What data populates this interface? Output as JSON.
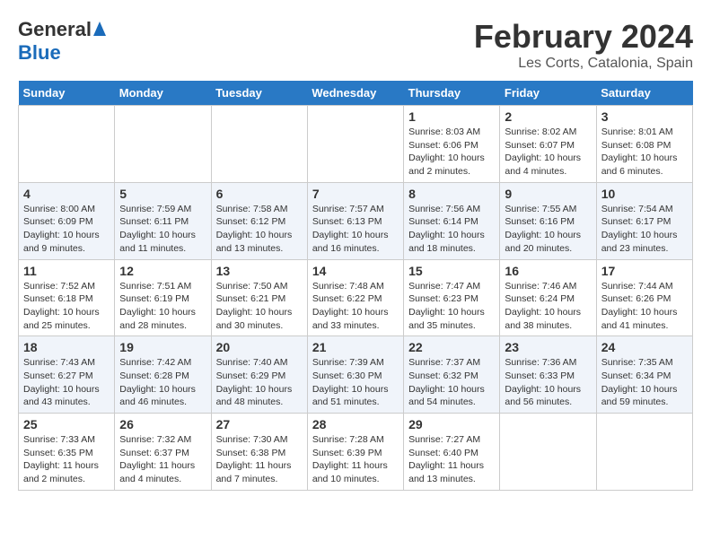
{
  "header": {
    "logo_general": "General",
    "logo_blue": "Blue",
    "month_title": "February 2024",
    "location": "Les Corts, Catalonia, Spain"
  },
  "calendar": {
    "weekdays": [
      "Sunday",
      "Monday",
      "Tuesday",
      "Wednesday",
      "Thursday",
      "Friday",
      "Saturday"
    ],
    "weeks": [
      [
        {
          "day": "",
          "info": ""
        },
        {
          "day": "",
          "info": ""
        },
        {
          "day": "",
          "info": ""
        },
        {
          "day": "",
          "info": ""
        },
        {
          "day": "1",
          "info": "Sunrise: 8:03 AM\nSunset: 6:06 PM\nDaylight: 10 hours\nand 2 minutes."
        },
        {
          "day": "2",
          "info": "Sunrise: 8:02 AM\nSunset: 6:07 PM\nDaylight: 10 hours\nand 4 minutes."
        },
        {
          "day": "3",
          "info": "Sunrise: 8:01 AM\nSunset: 6:08 PM\nDaylight: 10 hours\nand 6 minutes."
        }
      ],
      [
        {
          "day": "4",
          "info": "Sunrise: 8:00 AM\nSunset: 6:09 PM\nDaylight: 10 hours\nand 9 minutes."
        },
        {
          "day": "5",
          "info": "Sunrise: 7:59 AM\nSunset: 6:11 PM\nDaylight: 10 hours\nand 11 minutes."
        },
        {
          "day": "6",
          "info": "Sunrise: 7:58 AM\nSunset: 6:12 PM\nDaylight: 10 hours\nand 13 minutes."
        },
        {
          "day": "7",
          "info": "Sunrise: 7:57 AM\nSunset: 6:13 PM\nDaylight: 10 hours\nand 16 minutes."
        },
        {
          "day": "8",
          "info": "Sunrise: 7:56 AM\nSunset: 6:14 PM\nDaylight: 10 hours\nand 18 minutes."
        },
        {
          "day": "9",
          "info": "Sunrise: 7:55 AM\nSunset: 6:16 PM\nDaylight: 10 hours\nand 20 minutes."
        },
        {
          "day": "10",
          "info": "Sunrise: 7:54 AM\nSunset: 6:17 PM\nDaylight: 10 hours\nand 23 minutes."
        }
      ],
      [
        {
          "day": "11",
          "info": "Sunrise: 7:52 AM\nSunset: 6:18 PM\nDaylight: 10 hours\nand 25 minutes."
        },
        {
          "day": "12",
          "info": "Sunrise: 7:51 AM\nSunset: 6:19 PM\nDaylight: 10 hours\nand 28 minutes."
        },
        {
          "day": "13",
          "info": "Sunrise: 7:50 AM\nSunset: 6:21 PM\nDaylight: 10 hours\nand 30 minutes."
        },
        {
          "day": "14",
          "info": "Sunrise: 7:48 AM\nSunset: 6:22 PM\nDaylight: 10 hours\nand 33 minutes."
        },
        {
          "day": "15",
          "info": "Sunrise: 7:47 AM\nSunset: 6:23 PM\nDaylight: 10 hours\nand 35 minutes."
        },
        {
          "day": "16",
          "info": "Sunrise: 7:46 AM\nSunset: 6:24 PM\nDaylight: 10 hours\nand 38 minutes."
        },
        {
          "day": "17",
          "info": "Sunrise: 7:44 AM\nSunset: 6:26 PM\nDaylight: 10 hours\nand 41 minutes."
        }
      ],
      [
        {
          "day": "18",
          "info": "Sunrise: 7:43 AM\nSunset: 6:27 PM\nDaylight: 10 hours\nand 43 minutes."
        },
        {
          "day": "19",
          "info": "Sunrise: 7:42 AM\nSunset: 6:28 PM\nDaylight: 10 hours\nand 46 minutes."
        },
        {
          "day": "20",
          "info": "Sunrise: 7:40 AM\nSunset: 6:29 PM\nDaylight: 10 hours\nand 48 minutes."
        },
        {
          "day": "21",
          "info": "Sunrise: 7:39 AM\nSunset: 6:30 PM\nDaylight: 10 hours\nand 51 minutes."
        },
        {
          "day": "22",
          "info": "Sunrise: 7:37 AM\nSunset: 6:32 PM\nDaylight: 10 hours\nand 54 minutes."
        },
        {
          "day": "23",
          "info": "Sunrise: 7:36 AM\nSunset: 6:33 PM\nDaylight: 10 hours\nand 56 minutes."
        },
        {
          "day": "24",
          "info": "Sunrise: 7:35 AM\nSunset: 6:34 PM\nDaylight: 10 hours\nand 59 minutes."
        }
      ],
      [
        {
          "day": "25",
          "info": "Sunrise: 7:33 AM\nSunset: 6:35 PM\nDaylight: 11 hours\nand 2 minutes."
        },
        {
          "day": "26",
          "info": "Sunrise: 7:32 AM\nSunset: 6:37 PM\nDaylight: 11 hours\nand 4 minutes."
        },
        {
          "day": "27",
          "info": "Sunrise: 7:30 AM\nSunset: 6:38 PM\nDaylight: 11 hours\nand 7 minutes."
        },
        {
          "day": "28",
          "info": "Sunrise: 7:28 AM\nSunset: 6:39 PM\nDaylight: 11 hours\nand 10 minutes."
        },
        {
          "day": "29",
          "info": "Sunrise: 7:27 AM\nSunset: 6:40 PM\nDaylight: 11 hours\nand 13 minutes."
        },
        {
          "day": "",
          "info": ""
        },
        {
          "day": "",
          "info": ""
        }
      ]
    ]
  }
}
